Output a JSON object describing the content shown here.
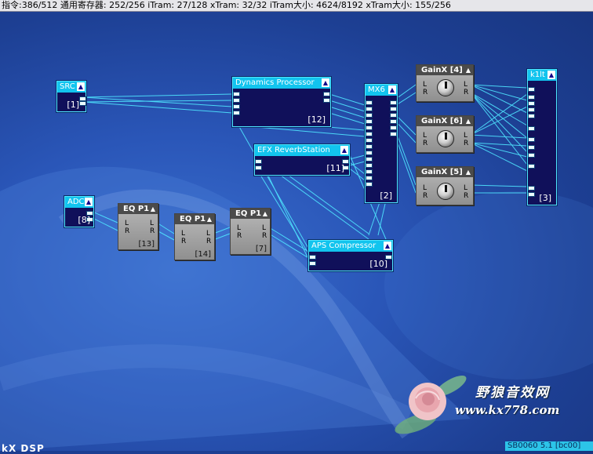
{
  "status_bar": "指令:386/512 通用寄存器: 252/256 iTram: 27/128 xTram: 32/32 iTram大小: 4624/8192 xTram大小: 155/256",
  "modules": {
    "src": {
      "title": "SRC",
      "index": "[1]"
    },
    "dynamics": {
      "title": "Dynamics Processor",
      "index": "[12]"
    },
    "efx": {
      "title": "EFX ReverbStation",
      "index": "[11]"
    },
    "mx6": {
      "title": "MX6",
      "index": "[2]"
    },
    "k1lt": {
      "title": "k1lt",
      "index": "[3]"
    },
    "adc": {
      "title": "ADC",
      "index": "[8]"
    },
    "aps": {
      "title": "APS Compressor",
      "index": "[10]"
    },
    "eq13": {
      "title": "EQ P1",
      "index": "[13]",
      "l": "L",
      "r": "R"
    },
    "eq14": {
      "title": "EQ P1",
      "index": "[14]",
      "l": "L",
      "r": "R"
    },
    "eq7": {
      "title": "EQ P1",
      "index": "[7]",
      "l": "L",
      "r": "R"
    },
    "gain4": {
      "title": "GainX [4]",
      "l": "L",
      "r": "R"
    },
    "gain6": {
      "title": "GainX [6]",
      "l": "L",
      "r": "R"
    },
    "gain5": {
      "title": "GainX [5]",
      "l": "L",
      "r": "R"
    }
  },
  "watermark": {
    "name": "野狼音效网",
    "url": "www.kx778.com"
  },
  "bottom_left": "kX DSP",
  "bottom_right": "SB0060 5.1 [bc00]",
  "colors": {
    "wire": "#4fe6ff",
    "module_title": "#12c4ee",
    "module_body": "#10105a",
    "gain_title": "#4b4b4b"
  }
}
